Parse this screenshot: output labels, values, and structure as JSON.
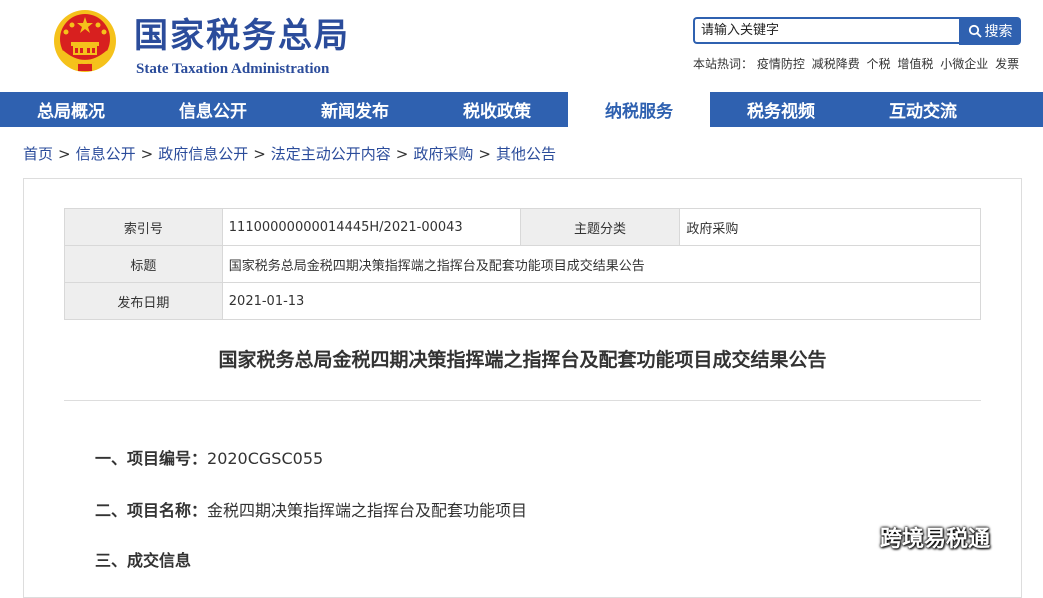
{
  "header": {
    "site_name": "国家税务总局",
    "site_name_en": "State Taxation Administration",
    "search_placeholder": "请输入关键字",
    "search_button": "搜索",
    "hot_label": "本站热词：",
    "hot_words": [
      "疫情防控",
      "减税降费",
      "个税",
      "增值税",
      "小微企业",
      "发票"
    ]
  },
  "nav": [
    {
      "label": "总局概况"
    },
    {
      "label": "信息公开"
    },
    {
      "label": "新闻发布"
    },
    {
      "label": "税收政策"
    },
    {
      "label": "纳税服务",
      "active": true
    },
    {
      "label": "税务视频"
    },
    {
      "label": "互动交流"
    }
  ],
  "breadcrumb": [
    "首页",
    "信息公开",
    "政府信息公开",
    "法定主动公开内容",
    "政府采购",
    "其他公告"
  ],
  "meta": {
    "index_label": "索引号",
    "index_value": "11100000000014445H/2021-00043",
    "topic_label": "主题分类",
    "topic_value": "政府采购",
    "title_label": "标题",
    "title_value": "国家税务总局金税四期决策指挥端之指挥台及配套功能项目成交结果公告",
    "date_label": "发布日期",
    "date_value": "2021-01-13"
  },
  "article": {
    "title": "国家税务总局金税四期决策指挥端之指挥台及配套功能项目成交结果公告",
    "sections": [
      {
        "label": "一、项目编号：",
        "value": "2020CGSC055"
      },
      {
        "label": "二、项目名称：",
        "value": "金税四期决策指挥端之指挥台及配套功能项目"
      },
      {
        "label": "三、成交信息",
        "value": ""
      }
    ]
  },
  "watermark": {
    "text": "跨境易税通",
    "icon": "wechat-icon"
  },
  "colors": {
    "brand_blue": "#2f61b0",
    "title_blue": "#2b4c9b",
    "emblem_red": "#d8201f",
    "emblem_gold": "#f5c21b"
  }
}
